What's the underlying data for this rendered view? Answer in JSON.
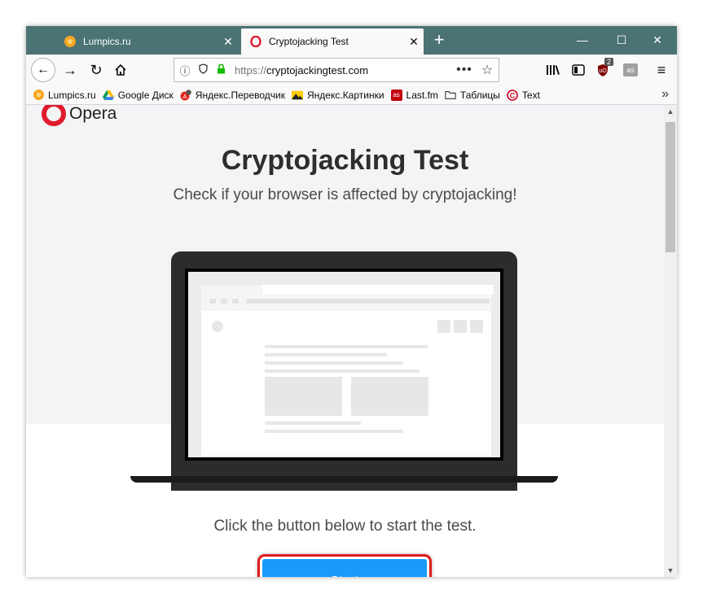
{
  "tabs": [
    {
      "title": "Lumpics.ru",
      "icon": "lumpics-favicon",
      "active": false
    },
    {
      "title": "Cryptojacking Test",
      "icon": "opera-favicon",
      "active": true
    }
  ],
  "window_controls": {
    "minimize": "—",
    "maximize": "☐",
    "close": "✕"
  },
  "navbar": {
    "url_scheme": "https://",
    "url_host": "cryptojackingtest.com",
    "page_actions": "•••",
    "ublock_badge": "2"
  },
  "bookmarks": [
    {
      "label": "Lumpics.ru",
      "icon": "lumpics-favicon"
    },
    {
      "label": "Google Диск",
      "icon": "google-drive-icon"
    },
    {
      "label": "Яндекс.Переводчик",
      "icon": "yandex-translate-icon"
    },
    {
      "label": "Яндекс.Картинки",
      "icon": "yandex-images-icon"
    },
    {
      "label": "Last.fm",
      "icon": "lastfm-icon"
    },
    {
      "label": "Таблицы",
      "icon": "folder-icon"
    },
    {
      "label": "Text",
      "icon": "copyright-icon"
    }
  ],
  "page": {
    "logo_text": "Opera",
    "heading": "Cryptojacking Test",
    "subheading": "Check if your browser is affected by cryptojacking!",
    "instruction": "Click the button below to start the test.",
    "start_label": "Start"
  },
  "colors": {
    "tabstrip": "#4b7373",
    "opera_red": "#e01a2d",
    "start_blue": "#1a9bfc",
    "highlight_red": "#e01a1a"
  }
}
